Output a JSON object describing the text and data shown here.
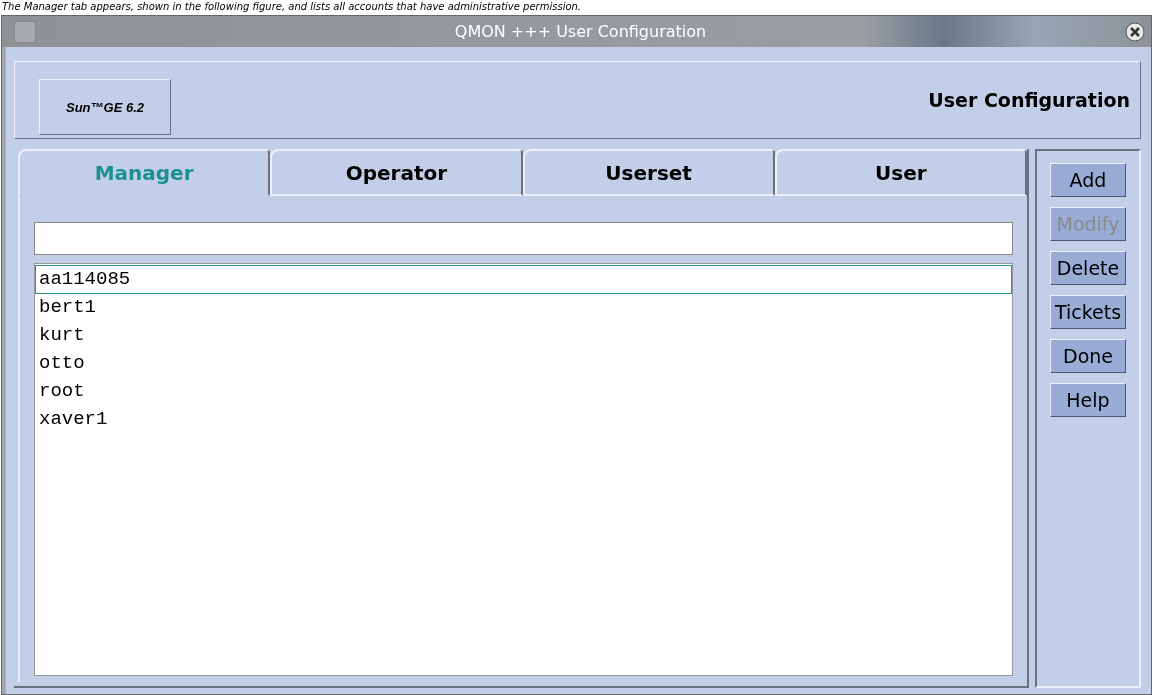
{
  "caption": "The Manager tab appears, shown in the following figure, and lists all accounts that have administrative permission.",
  "window": {
    "title": "QMON  +++  User Configuration"
  },
  "logo_button": "Sun™GE 6.2",
  "heading": "User Configuration",
  "tabs": [
    {
      "label": "Manager",
      "selected": true
    },
    {
      "label": "Operator",
      "selected": false
    },
    {
      "label": "Userset",
      "selected": false
    },
    {
      "label": "User",
      "selected": false
    }
  ],
  "accounts": [
    {
      "name": "aa114085",
      "selected": true
    },
    {
      "name": "bert1",
      "selected": false
    },
    {
      "name": "kurt",
      "selected": false
    },
    {
      "name": "otto",
      "selected": false
    },
    {
      "name": "root",
      "selected": false
    },
    {
      "name": "xaver1",
      "selected": false
    }
  ],
  "buttons": [
    {
      "label": "Add",
      "disabled": false
    },
    {
      "label": "Modify",
      "disabled": true
    },
    {
      "label": "Delete",
      "disabled": false
    },
    {
      "label": "Tickets",
      "disabled": false
    },
    {
      "label": "Done",
      "disabled": false
    },
    {
      "label": "Help",
      "disabled": false
    }
  ]
}
